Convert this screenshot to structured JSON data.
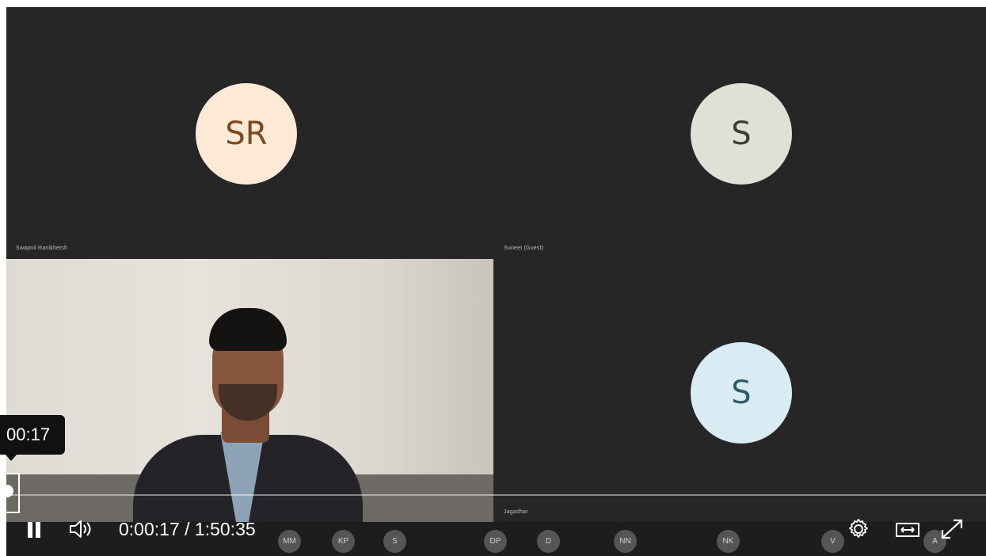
{
  "meeting": {
    "tiles": [
      {
        "initials": "SR",
        "name": "Swapnil Ranikhetsh"
      },
      {
        "initials": "S",
        "name": "Suneet (Guest)"
      },
      {
        "initials": "",
        "name": ""
      },
      {
        "initials": "S",
        "name": "Jagadhar"
      }
    ],
    "participants": [
      "MM",
      "KP",
      "S",
      "DP",
      "D",
      "NN",
      "NK",
      "V",
      "A"
    ]
  },
  "player": {
    "tooltip_time": "00:17",
    "current_time": "0:00:17",
    "separator": "/",
    "duration": "1:50:35",
    "progress_fraction": 0.0026
  },
  "icons": {
    "pause": "pause-icon",
    "volume": "volume-icon",
    "settings": "gear-icon",
    "width": "expand-width-icon",
    "fullscreen": "fullscreen-icon"
  },
  "colors": {
    "avatar_sr_bg": "#fde9d5",
    "avatar_s1_bg": "#dfe1d6",
    "avatar_s2_bg": "#d9ecf3",
    "tile_bg": "#262626"
  }
}
